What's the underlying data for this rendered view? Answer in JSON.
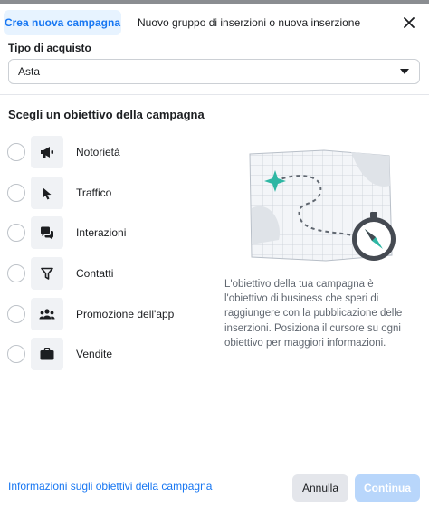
{
  "tabs": {
    "active": "Crea nuova campagna",
    "inactive": "Nuovo gruppo di inserzioni o nuova inserzione"
  },
  "buy_type": {
    "label": "Tipo di acquisto",
    "value": "Asta"
  },
  "objectives": {
    "title": "Scegli un obiettivo della campagna",
    "items": [
      {
        "label": "Notorietà",
        "icon": "megaphone-icon"
      },
      {
        "label": "Traffico",
        "icon": "cursor-icon"
      },
      {
        "label": "Interazioni",
        "icon": "chat-bubbles-icon"
      },
      {
        "label": "Contatti",
        "icon": "funnel-icon"
      },
      {
        "label": "Promozione dell'app",
        "icon": "people-icon"
      },
      {
        "label": "Vendite",
        "icon": "briefcase-icon"
      }
    ]
  },
  "description": "L'obiettivo della tua campagna è l'obiettivo di business che speri di raggiungere con la pubblicazione delle inserzioni. Posiziona il cursore su ogni obiettivo per maggiori informazioni.",
  "footer": {
    "link": "Informazioni sugli obiettivi della campagna",
    "cancel": "Annulla",
    "continue": "Continua"
  },
  "colors": {
    "accent": "#1877f2",
    "accent_light": "#e7f3ff",
    "disabled_button": "#b8d6fb",
    "illustration_teal": "#2fb7a4"
  }
}
